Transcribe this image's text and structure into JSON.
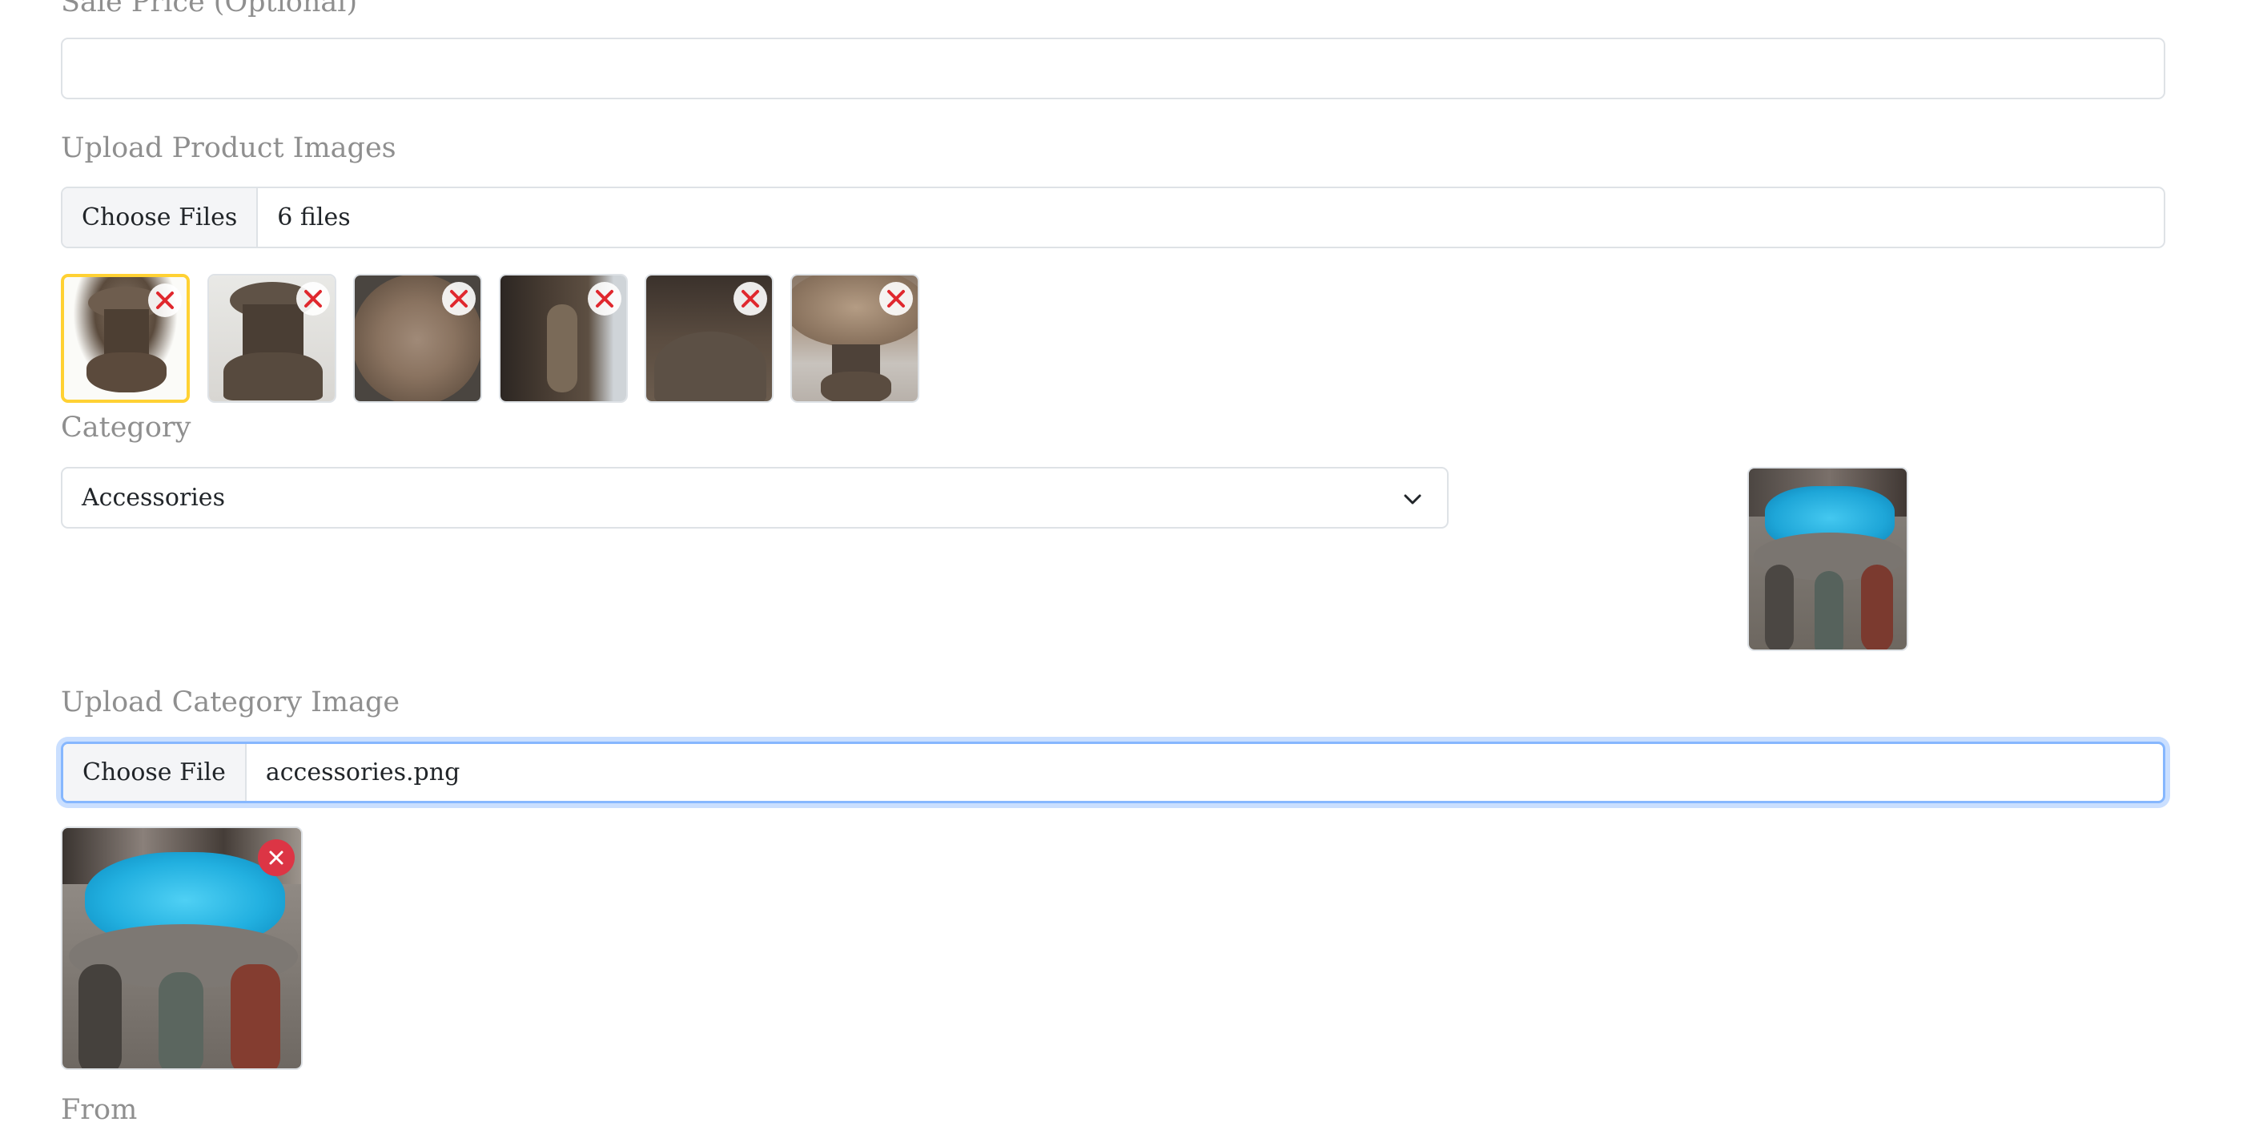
{
  "form": {
    "sale_price": {
      "label": "Sale Price (Optional)",
      "value": ""
    },
    "product_images": {
      "label": "Upload Product Images",
      "button_label": "Choose Files",
      "status_text": "6 files",
      "thumbnails": [
        {
          "name": "product-thumb-1",
          "selected": true
        },
        {
          "name": "product-thumb-2",
          "selected": false
        },
        {
          "name": "product-thumb-3",
          "selected": false
        },
        {
          "name": "product-thumb-4",
          "selected": false
        },
        {
          "name": "product-thumb-5",
          "selected": false
        },
        {
          "name": "product-thumb-6",
          "selected": false
        }
      ]
    },
    "category": {
      "label": "Category",
      "selected": "Accessories"
    },
    "category_image": {
      "label": "Upload Category Image",
      "button_label": "Choose File",
      "file_name": "accessories.png"
    },
    "from": {
      "label": "From"
    }
  },
  "icons": {
    "remove_thumb": "close-icon",
    "select_arrow": "chevron-down-icon"
  },
  "colors": {
    "selected_border": "#ffd133",
    "remove_x": "#e0282e",
    "remove_button": "#dc3545",
    "focus_ring": "#86b7fe",
    "label_text": "#8f8f8f"
  }
}
